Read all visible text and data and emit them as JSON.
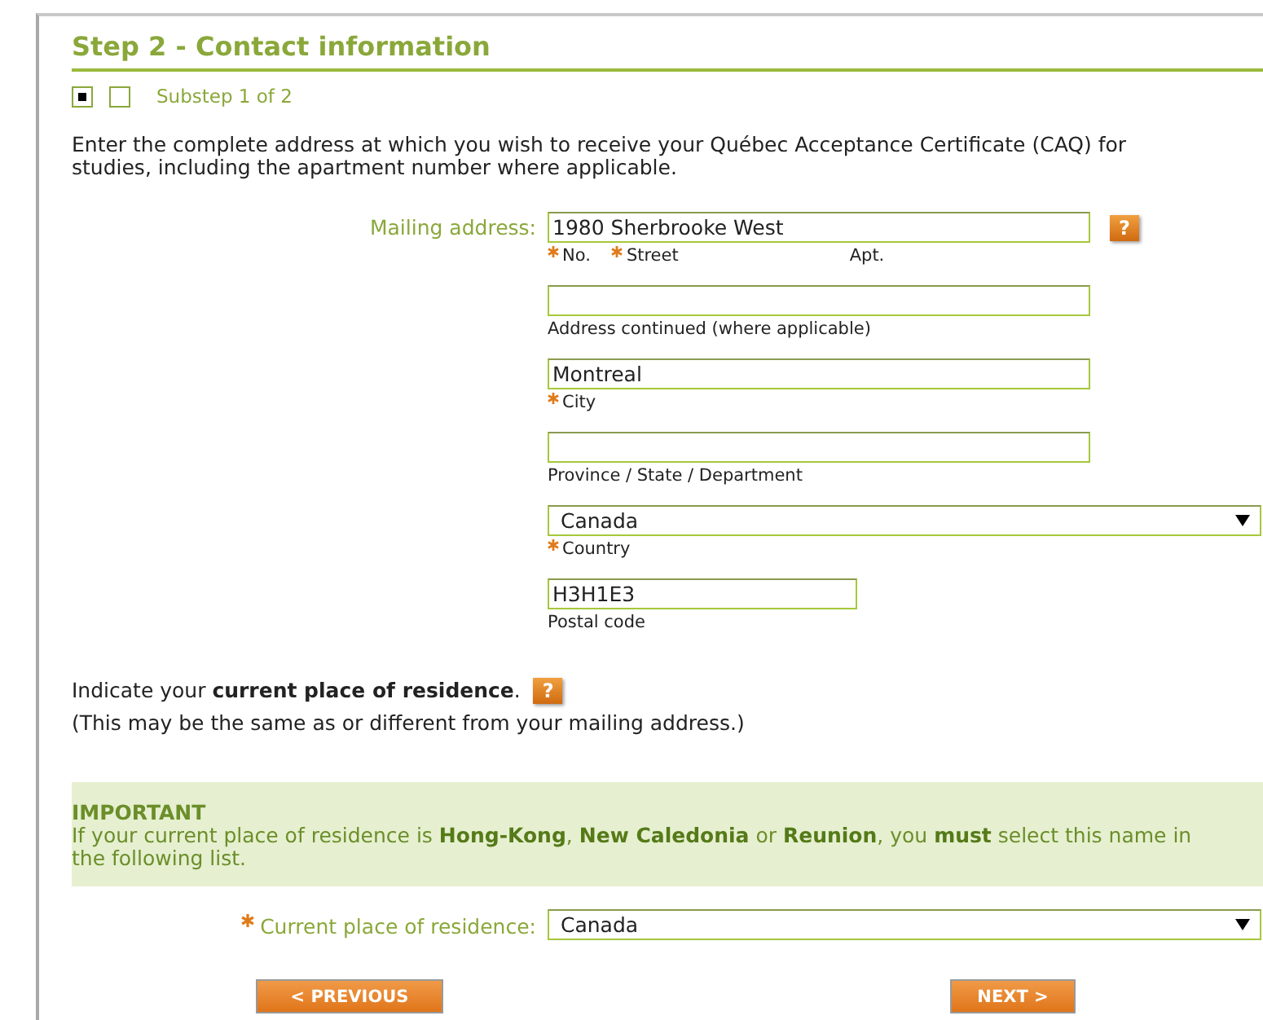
{
  "step_title": "Step 2 - Contact information",
  "substeps": [
    {
      "selected": true
    },
    {
      "selected": false
    }
  ],
  "substep_label": "Substep 1 of 2",
  "intro": "Enter the complete address at which you wish to receive your Québec Acceptance Certificate (CAQ) for studies, including the apartment number where applicable.",
  "mailing_label": "Mailing address:",
  "fields": [
    {
      "kind": "text",
      "value": "1980 Sherbrooke West",
      "help": "?",
      "sublabels": [
        {
          "text": "No.",
          "required": true
        },
        {
          "text": "Street",
          "required": true
        },
        {
          "text": "Apt.",
          "required": false
        }
      ]
    },
    {
      "kind": "text",
      "sublabels": [
        {
          "text": "Address continued (where applicable)",
          "required": false
        }
      ]
    },
    {
      "kind": "text",
      "value": "Montreal",
      "sublabels": [
        {
          "text": "City",
          "required": true
        }
      ]
    },
    {
      "kind": "text",
      "sublabels": [
        {
          "text": "Province / State / Department",
          "required": false
        }
      ]
    },
    {
      "kind": "select",
      "value": "Canada",
      "sublabels": [
        {
          "text": "Country",
          "required": true
        }
      ]
    },
    {
      "kind": "short_text",
      "value": "H3H1E3",
      "sublabels": [
        {
          "text": "Postal code",
          "required": false
        }
      ]
    }
  ],
  "residence_intro": "Indicate your **current place of residence**.",
  "residence_help": "?",
  "residence_note": "(This may be the same as or different from your mailing address.)",
  "important": {
    "heading": "IMPORTANT",
    "text": "If your current place of residence is **Hong-Kong**, **New Caledonia** or **Reunion**, you **must** select this name in the following list."
  },
  "residence_field": {
    "label": "Current place of residence:",
    "required": true,
    "value": "Canada"
  },
  "buttons": [
    {
      "label": "< PREVIOUS"
    },
    {
      "label": "NEXT >"
    }
  ]
}
